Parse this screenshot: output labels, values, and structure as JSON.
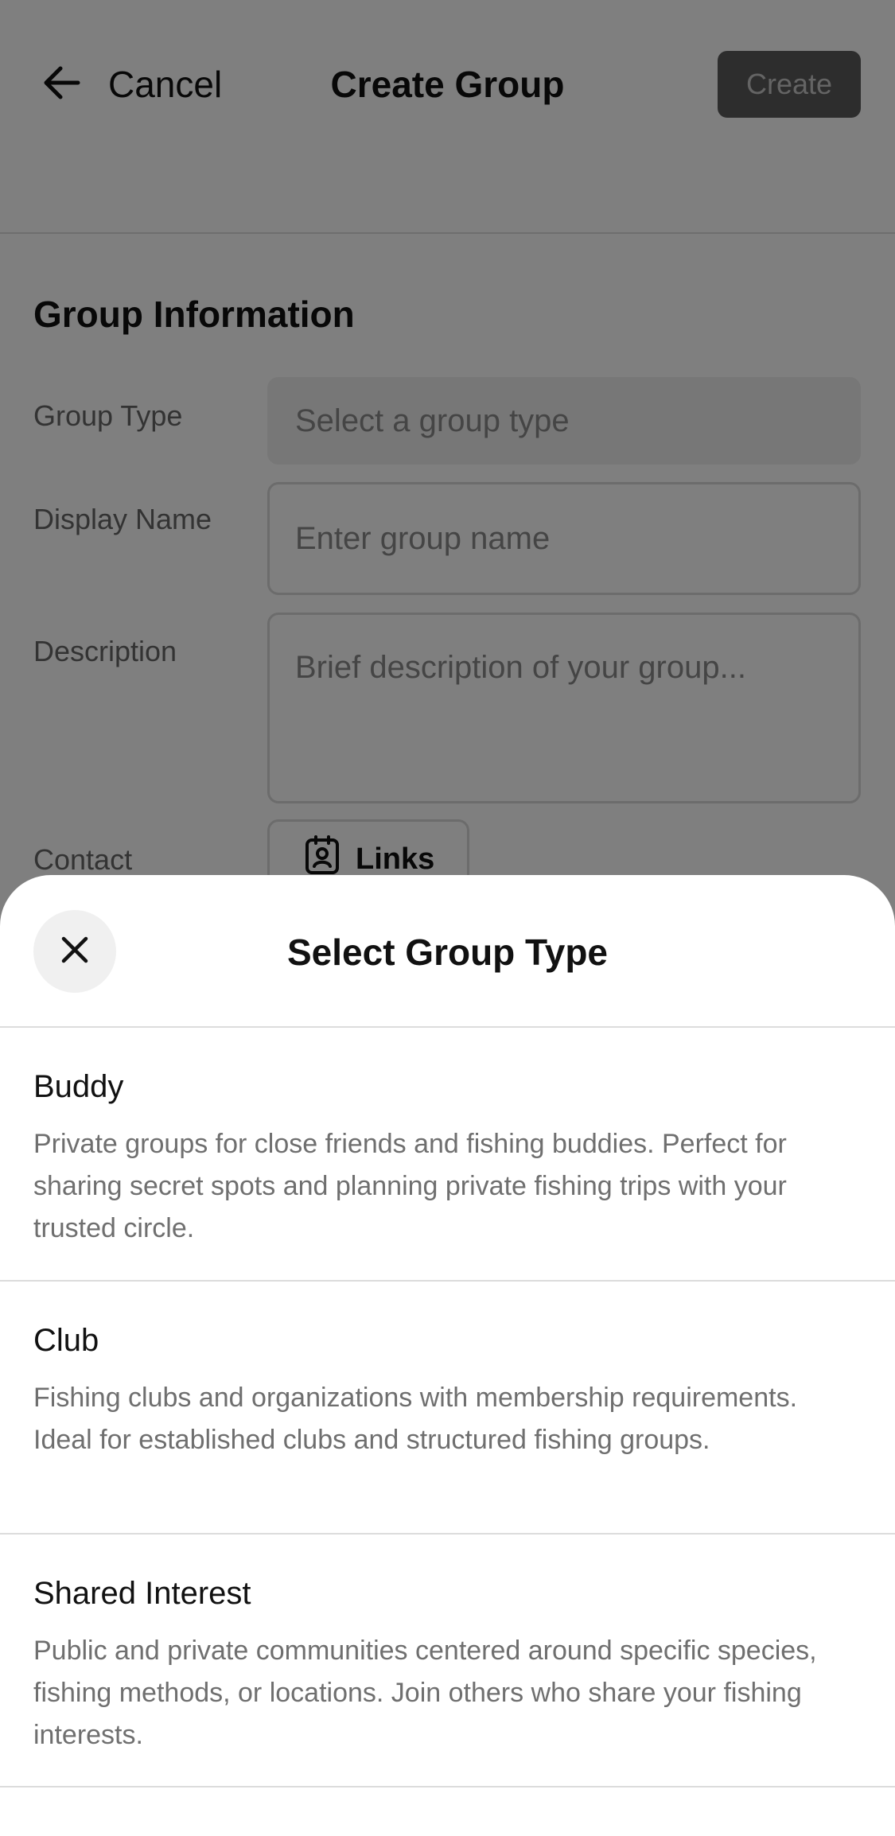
{
  "header": {
    "cancel_label": "Cancel",
    "title": "Create Group",
    "create_label": "Create"
  },
  "form": {
    "section_title": "Group Information",
    "group_type": {
      "label": "Group Type",
      "placeholder": "Select a group type"
    },
    "display_name": {
      "label": "Display Name",
      "placeholder": "Enter group name"
    },
    "description": {
      "label": "Description",
      "placeholder": "Brief description of your group..."
    },
    "contact": {
      "label": "Contact",
      "links_label": "Links"
    }
  },
  "sheet": {
    "title": "Select Group Type",
    "options": [
      {
        "title": "Buddy",
        "description": "Private groups for close friends and fishing buddies. Perfect for sharing secret spots and planning private fishing trips with your trusted circle."
      },
      {
        "title": "Club",
        "description": "Fishing clubs and organizations with membership requirements. Ideal for established clubs and structured fishing groups."
      },
      {
        "title": "Shared Interest",
        "description": "Public and private communities centered around specific species, fishing methods, or locations. Join others who share your fishing interests."
      }
    ]
  },
  "icons": {
    "back": "arrow-left-icon",
    "close": "close-icon",
    "links": "contact-card-icon"
  },
  "colors": {
    "overlay": "#00000080",
    "create_button_bg": "#5a5a5a",
    "text_primary": "#111111",
    "text_secondary": "#6f6f6f"
  }
}
